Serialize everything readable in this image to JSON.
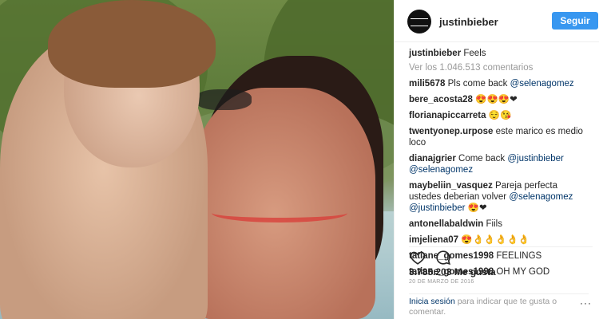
{
  "header": {
    "username": "justinbieber",
    "follow_label": "Seguir"
  },
  "caption": {
    "user": "justinbieber",
    "text": "Feels"
  },
  "load_more": "Ver los 1.046.513 comentarios",
  "comments": [
    {
      "user": "mili5678",
      "text": "Pls come back ",
      "mention": "@selenagomez"
    },
    {
      "user": "bere_acosta28",
      "text": "😍😍😍❤"
    },
    {
      "user": "florianapiccarreta",
      "text": "😌😘"
    },
    {
      "user": "twentyonep.urpose",
      "text": "este marico es medio loco"
    },
    {
      "user": "dianajgrier",
      "text": "Come back ",
      "mention": "@justinbieber @selenagomez"
    },
    {
      "user": "maybeliin_vasquez",
      "text": "Pareja perfecta ustedes deberian volver ",
      "mention": "@selenagomez @justinbieber",
      "tail": " 😍❤"
    },
    {
      "user": "antonellabaldwin",
      "text": "Fiils"
    },
    {
      "user": "imjeliena07",
      "text": "😍👌👌👌👌👌"
    },
    {
      "user": "tatiane_gomes1998",
      "text": "FEELINGS"
    },
    {
      "user": "tatiane_gomes1998",
      "text": "OH MY GOD"
    }
  ],
  "likes": "3.785.203 Me gusta",
  "date": "20 DE MARZO DE 2016",
  "login": {
    "link": "Inicia sesión",
    "text": " para indicar que te gusta o comentar."
  },
  "more_label": "···",
  "colors": {
    "follow_button": "#3897f0",
    "mention": "#003569",
    "muted": "#999999"
  }
}
